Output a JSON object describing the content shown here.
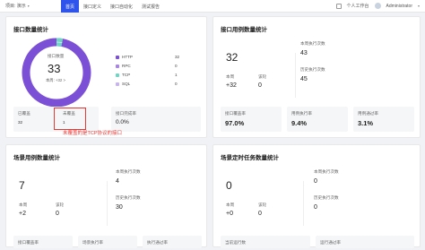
{
  "topbar": {
    "project": "项目: 演示",
    "tabs": [
      {
        "label": "首页"
      },
      {
        "label": "接口定义"
      },
      {
        "label": "接口自动化"
      },
      {
        "label": "测试报告"
      }
    ],
    "right_text": "个人工作台",
    "user": "Administrator"
  },
  "api_card": {
    "title": "接口数量统计",
    "donut_label": "接口数量",
    "donut_value": "33",
    "donut_week": "本周: +32 >",
    "legend": [
      {
        "name": "HTTP",
        "value": "32",
        "color": "#7b4fd6"
      },
      {
        "name": "RPC",
        "value": "0",
        "color": "#a884e8"
      },
      {
        "name": "TCP",
        "value": "1",
        "color": "#6fd6c6"
      },
      {
        "name": "SQL",
        "value": "0",
        "color": "#c7b3f0"
      }
    ],
    "covered_label": "已覆盖",
    "covered_value": "32",
    "uncovered_label": "未覆盖",
    "uncovered_value": "1",
    "coverage_label": "接口完成率",
    "coverage_value": "0.0%"
  },
  "case_card": {
    "title": "接口用例数量统计",
    "count": "32",
    "week_label": "本周",
    "week_value": "+32",
    "review_label": "该轮",
    "review_value": "0",
    "exec_label": "本周执行次数",
    "exec_value": "43",
    "history_label": "历史执行次数",
    "history_value": "45",
    "coverage_label": "接口覆盖率",
    "coverage_value": "97.0%",
    "exec_rate_label": "用例执行率",
    "exec_rate_value": "9.4%",
    "pass_rate_label": "用例通过率",
    "pass_rate_value": "3.1%"
  },
  "scenario_card": {
    "title": "场景用例数量统计",
    "count": "7",
    "week_label": "本周",
    "week_value": "+2",
    "review_label": "该轮",
    "review_value": "0",
    "exec_label": "本周执行次数",
    "exec_value": "4",
    "history_label": "历史执行次数",
    "history_value": "30",
    "b1": "接口覆盖率",
    "b2": "场景执行率",
    "b3": "执行通过率"
  },
  "schedule_card": {
    "title": "场景定时任务数量统计",
    "count": "0",
    "week_label": "本周",
    "week_value": "+0",
    "review_label": "该轮",
    "review_value": "0",
    "exec_label": "本周执行次数",
    "exec_value": "0",
    "history_label": "历史执行次数",
    "history_value": "0",
    "b1": "当前运行数",
    "b2": "运行通过率"
  },
  "annotation": {
    "text": "未覆盖的是TCP协议的接口",
    "color": "#e53935"
  }
}
